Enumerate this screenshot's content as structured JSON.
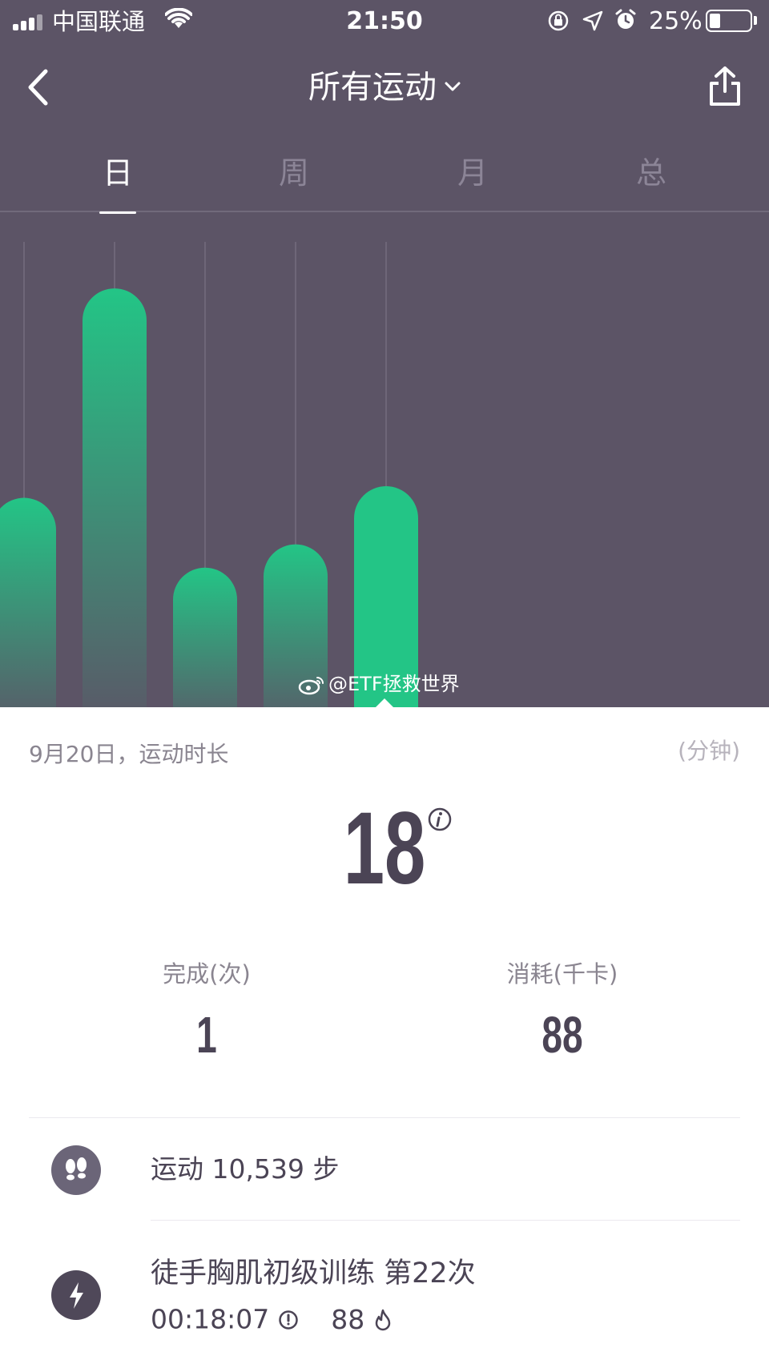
{
  "status_bar": {
    "carrier": "中国联通",
    "time": "21:50",
    "battery": "25%",
    "battery_level": 0.25
  },
  "header": {
    "title": "所有运动"
  },
  "tabs": [
    {
      "label": "日",
      "active": true
    },
    {
      "label": "周",
      "active": false
    },
    {
      "label": "月",
      "active": false
    },
    {
      "label": "总",
      "active": false
    }
  ],
  "chart_data": {
    "type": "bar",
    "values": [
      18,
      36,
      12,
      14,
      19
    ],
    "selected_index": 4,
    "ylim": [
      0,
      40
    ],
    "colors": {
      "bar_top": "#23c586",
      "bar_bottom": "#5c5466",
      "background": "#5c5466",
      "grid": "#7a7384"
    }
  },
  "watermark": "@ETF拯救世界",
  "summary": {
    "date_label": "9月20日，运动时长",
    "unit": "(分钟)",
    "duration": "18",
    "completed_label": "完成(次)",
    "completed_value": "1",
    "calories_label": "消耗(千卡)",
    "calories_value": "88"
  },
  "records": {
    "steps": "运动 10,539 步",
    "workout_title": "徒手胸肌初级训练  第22次",
    "workout_time": "00:18:07",
    "workout_calories": "88"
  },
  "icons": {
    "back": "chevron-left-icon",
    "share": "share-icon",
    "steps": "footprints-icon",
    "workout": "lightning-icon",
    "info": "info-icon",
    "clock": "clock-icon",
    "fire": "fire-icon"
  }
}
